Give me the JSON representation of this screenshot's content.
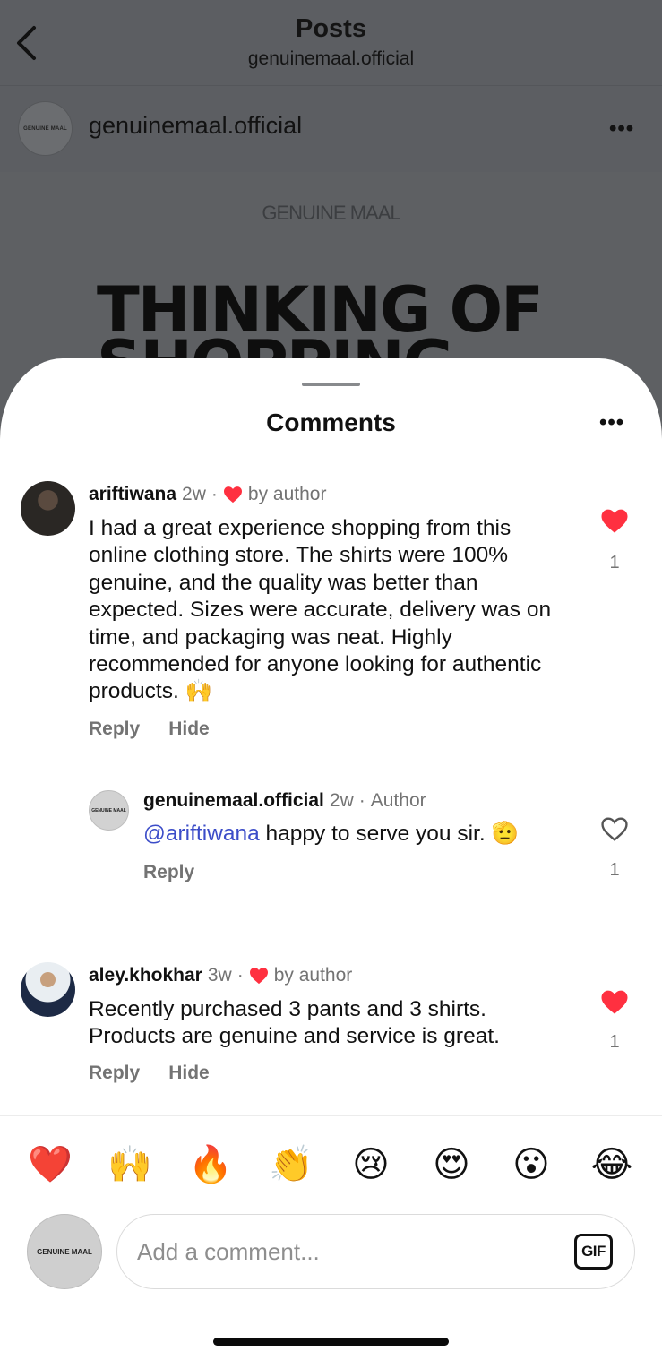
{
  "header": {
    "title": "Posts",
    "subtitle": "genuinemaal.official"
  },
  "post": {
    "username": "genuinemaal.official",
    "avatar_text": "GENUINE MAAL",
    "image": {
      "brand": "GENUINE MAAL",
      "headline": "THINKING OF",
      "headline_partial": "SHOPPING"
    }
  },
  "comments_sheet": {
    "title": "Comments",
    "comments": [
      {
        "username": "ariftiwana",
        "time": "2w",
        "badge": "by author",
        "text": "I had a great experience shopping from this online clothing store. The shirts were 100% genuine, and the quality was better than expected. Sizes were accurate, delivery was on time, and packaging was neat. Highly recommended for anyone looking for authentic products. 🙌",
        "like_count": "1",
        "liked": true,
        "reply_label": "Reply",
        "hide_label": "Hide"
      },
      {
        "username": "genuinemaal.official",
        "time": "2w",
        "badge": "Author",
        "mention": "@ariftiwana",
        "text": " happy to serve you sir. 🫡",
        "like_count": "1",
        "liked": false,
        "reply_label": "Reply",
        "avatar_text": "GENUINE MAAL"
      },
      {
        "username": "aley.khokhar",
        "time": "3w",
        "badge": "by author",
        "text": "Recently purchased 3 pants and 3 shirts. Products are genuine and service is great.",
        "like_count": "1",
        "liked": true,
        "reply_label": "Reply",
        "hide_label": "Hide"
      }
    ]
  },
  "emoji_bar": [
    "❤️",
    "🙌",
    "🔥",
    "👏",
    "😢",
    "😍",
    "😮",
    "😂"
  ],
  "composer": {
    "avatar_text": "GENUINE MAAL",
    "placeholder": "Add a comment...",
    "gif_label": "GIF"
  },
  "colors": {
    "like_red": "#ff3040",
    "mention_blue": "#3b4cc8",
    "muted_text": "#737373"
  }
}
